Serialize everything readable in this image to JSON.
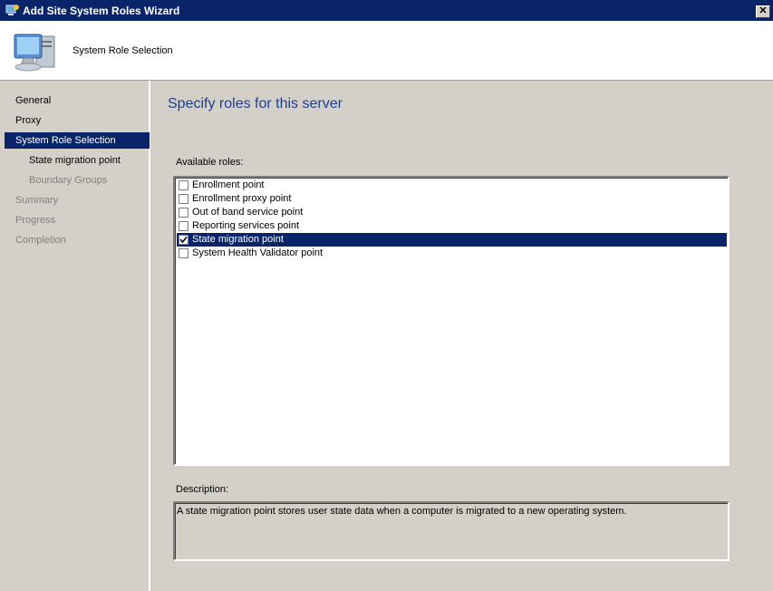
{
  "window": {
    "title": "Add Site System Roles Wizard",
    "close_glyph": "✕"
  },
  "header": {
    "title": "System Role Selection",
    "icon": "computer-server-icon"
  },
  "sidebar": {
    "items": [
      {
        "label": "General",
        "state": "normal"
      },
      {
        "label": "Proxy",
        "state": "normal"
      },
      {
        "label": "System Role Selection",
        "state": "selected"
      },
      {
        "label": "State migration point",
        "state": "normal",
        "indent": true
      },
      {
        "label": "Boundary Groups",
        "state": "disabled",
        "indent": true
      },
      {
        "label": "Summary",
        "state": "disabled"
      },
      {
        "label": "Progress",
        "state": "disabled"
      },
      {
        "label": "Completion",
        "state": "disabled"
      }
    ]
  },
  "main": {
    "heading": "Specify roles for this server",
    "roles_label": "Available roles:",
    "roles": [
      {
        "label": "Enrollment point",
        "checked": false,
        "selected": false
      },
      {
        "label": "Enrollment proxy point",
        "checked": false,
        "selected": false
      },
      {
        "label": "Out of band service point",
        "checked": false,
        "selected": false
      },
      {
        "label": "Reporting services point",
        "checked": false,
        "selected": false
      },
      {
        "label": "State migration point",
        "checked": true,
        "selected": true
      },
      {
        "label": "System Health Validator point",
        "checked": false,
        "selected": false
      }
    ],
    "description_label": "Description:",
    "description": "A state migration point stores user state data when a computer is migrated to a new operating system."
  },
  "colors": {
    "selection": "#0a246a",
    "heading": "#1c3f95",
    "disabled_text": "#808080"
  }
}
